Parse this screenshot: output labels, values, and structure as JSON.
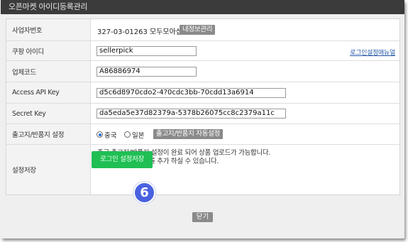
{
  "window": {
    "title": "오픈마켓 아이디등록관리",
    "close_label": "닫기"
  },
  "form": {
    "business_number": {
      "label": "사업자번호",
      "value": "327-03-01263 모두모아샵",
      "button_label": "내정보관리"
    },
    "coupang_id": {
      "label": "쿠팡 아이디",
      "value": "sellerpick",
      "link_label": "로그인설정매뉴얼"
    },
    "vendor_code": {
      "label": "업체코드",
      "value": "A86886974"
    },
    "access_key": {
      "label": "Access API Key",
      "value": "d5c6d8970cdo2-4?0cdc3bb-70cdd13a6914"
    },
    "secret_key": {
      "label": "Secret Key",
      "value": "da5eda5e37d82379a-5378b26075cc8c2379a11c"
    },
    "shipping": {
      "label": "출고지/반품지 설정",
      "option_china": "중국",
      "option_japan": "일본",
      "selected": "중국",
      "auto_button_label": "출고지/반품지 자동설정"
    },
    "save": {
      "label": "설정저장",
      "note_line1": "중국 출고지/반품지 설정이 완료 되어 상품 업로드가 가능합니다.",
      "note_line2": "일본 출고지/반품지를 추가 하실 수 있습니다.",
      "button_label": "로그인 설정저장"
    }
  },
  "step_badge": "6",
  "colors": {
    "titlebar": "#3b3b3b",
    "save_button": "#1fbf53",
    "badge": "#4a62e0",
    "gray_button": "#8a8a8a",
    "link": "#2a5caa"
  }
}
